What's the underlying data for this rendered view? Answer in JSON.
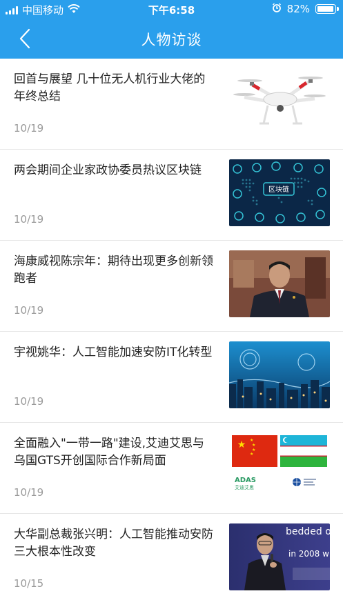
{
  "status_bar": {
    "carrier": "中国移动",
    "time": "下午6:58",
    "battery": "82%",
    "signal_icon": "signal-icon",
    "wifi_icon": "wifi-icon",
    "alarm_icon": "alarm-icon",
    "battery_icon": "battery-icon"
  },
  "nav": {
    "title": "人物访谈",
    "back_icon": "chevron-left-icon"
  },
  "colors": {
    "header_bg": "#2a9fec",
    "date_text": "#9a9a9a"
  },
  "articles": [
    {
      "title": "回首与展望 几十位无人机行业大佬的年终总结",
      "date": "10/19"
    },
    {
      "title": "两会期间企业家政协委员热议区块链",
      "date": "10/19",
      "thumb_text": "区块链"
    },
    {
      "title": "海康威视陈宗年：期待出现更多创新领跑者",
      "date": "10/19"
    },
    {
      "title": "宇视姚华：人工智能加速安防IT化转型",
      "date": "10/19"
    },
    {
      "title": "全面融入\"一带一路\"建设,艾迪艾思与乌国GTS开创国际合作新局面",
      "date": "10/19",
      "thumb_text": "ADAS",
      "thumb_subtext": "艾迪艾思"
    },
    {
      "title": "大华副总裁张兴明：人工智能推动安防三大根本性改变",
      "date": "10/15",
      "thumb_text": "bedded ov",
      "thumb_subtext": "in 2008 w"
    }
  ]
}
